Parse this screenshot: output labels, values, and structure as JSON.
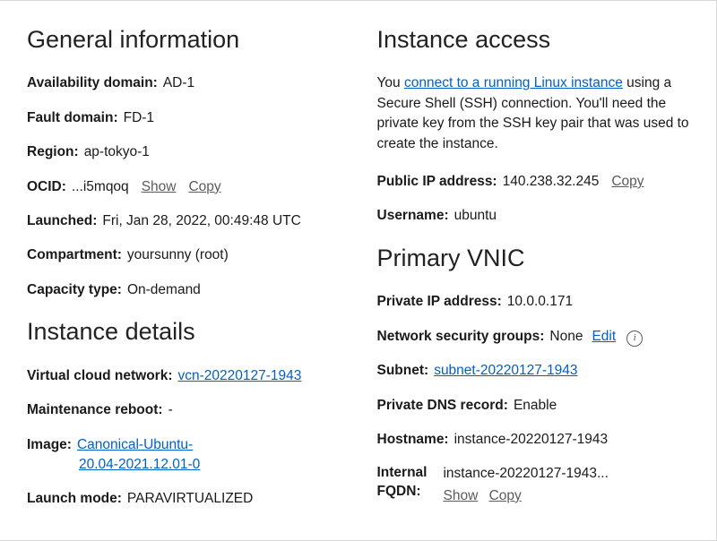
{
  "general": {
    "heading": "General information",
    "availability_domain_label": "Availability domain:",
    "availability_domain_value": "AD-1",
    "fault_domain_label": "Fault domain:",
    "fault_domain_value": "FD-1",
    "region_label": "Region:",
    "region_value": "ap-tokyo-1",
    "ocid_label": "OCID:",
    "ocid_value": "...i5mqoq",
    "ocid_show": "Show",
    "ocid_copy": "Copy",
    "launched_label": "Launched:",
    "launched_value": "Fri, Jan 28, 2022, 00:49:48 UTC",
    "compartment_label": "Compartment:",
    "compartment_value": "yoursunny (root)",
    "capacity_type_label": "Capacity type:",
    "capacity_type_value": "On-demand"
  },
  "details": {
    "heading": "Instance details",
    "vcn_label": "Virtual cloud network:",
    "vcn_link": "vcn-20220127-1943",
    "maintenance_label": "Maintenance reboot:",
    "maintenance_value": "-",
    "image_label": "Image:",
    "image_link_line1": "Canonical-Ubuntu-",
    "image_link_line2": "20.04-2021.12.01-0",
    "launch_mode_label": "Launch mode:",
    "launch_mode_value": "PARAVIRTUALIZED"
  },
  "access": {
    "heading": "Instance access",
    "para_pre": "You ",
    "para_link": "connect to a running Linux instance",
    "para_post": " using a Secure Shell (SSH) connection. You'll need the private key from the SSH key pair that was used to create the instance.",
    "public_ip_label": "Public IP address:",
    "public_ip_value": "140.238.32.245",
    "public_ip_copy": "Copy",
    "username_label": "Username:",
    "username_value": "ubuntu"
  },
  "vnic": {
    "heading": "Primary VNIC",
    "private_ip_label": "Private IP address:",
    "private_ip_value": "10.0.0.171",
    "nsg_label": "Network security groups:",
    "nsg_value": "None",
    "nsg_edit": "Edit",
    "subnet_label": "Subnet:",
    "subnet_link": "subnet-20220127-1943",
    "dns_label": "Private DNS record:",
    "dns_value": "Enable",
    "hostname_label": "Hostname:",
    "hostname_value": "instance-20220127-1943",
    "fqdn_label_l1": "Internal",
    "fqdn_label_l2": "FQDN:",
    "fqdn_value": "instance-20220127-1943...",
    "fqdn_show": "Show",
    "fqdn_copy": "Copy"
  }
}
